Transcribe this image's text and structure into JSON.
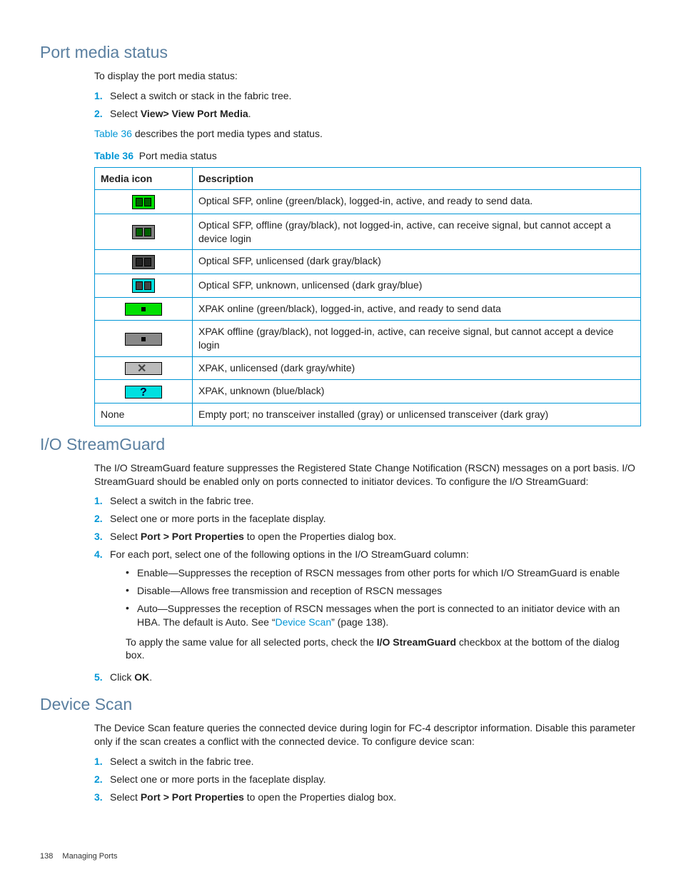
{
  "sections": {
    "portMedia": {
      "title": "Port media status",
      "intro": "To display the port media status:",
      "steps": [
        {
          "n": "1.",
          "text": "Select a switch or stack in the fabric tree."
        },
        {
          "n": "2.",
          "prefix": "Select ",
          "bold": "View> View Port Media",
          "suffix": "."
        }
      ],
      "afterSteps": {
        "link": "Table 36",
        "rest": " describes the port media types and status."
      },
      "tableCaption": {
        "label": "Table 36",
        "title": "Port media status"
      },
      "tableHeaders": {
        "c1": "Media icon",
        "c2": "Description"
      },
      "rows": [
        {
          "icon": "sfp-green",
          "desc": "Optical SFP, online (green/black), logged-in, active, and ready to send data."
        },
        {
          "icon": "sfp-gray",
          "desc": "Optical SFP, offline (gray/black), not logged-in, active, can receive signal, but cannot accept a device login"
        },
        {
          "icon": "sfp-dark",
          "desc": "Optical SFP, unlicensed (dark gray/black)"
        },
        {
          "icon": "sfp-blue",
          "desc": "Optical SFP, unknown, unlicensed (dark gray/blue)"
        },
        {
          "icon": "xpak-green",
          "desc": "XPAK online (green/black), logged-in, active, and ready to send data"
        },
        {
          "icon": "xpak-gray",
          "desc": "XPAK offline (gray/black), not logged-in, active, can receive signal, but cannot accept a device login"
        },
        {
          "icon": "xpak-white",
          "desc": "XPAK, unlicensed (dark gray/white)"
        },
        {
          "icon": "xpak-blue",
          "desc": "XPAK, unknown (blue/black)"
        },
        {
          "icon": "none",
          "iconText": "None",
          "desc": "Empty port; no transceiver installed (gray) or unlicensed transceiver (dark gray)"
        }
      ]
    },
    "streamGuard": {
      "title": "I/O StreamGuard",
      "intro": "The I/O StreamGuard feature suppresses the Registered State Change Notification (RSCN) messages on a port basis. I/O StreamGuard should be enabled only on ports connected to initiator devices. To configure the I/O StreamGuard:",
      "steps": {
        "s1": {
          "n": "1.",
          "text": "Select a switch in the fabric tree."
        },
        "s2": {
          "n": "2.",
          "text": "Select one or more ports in the faceplate display."
        },
        "s3": {
          "n": "3.",
          "prefix": "Select ",
          "bold": "Port > Port Properties",
          "suffix": " to open the Properties dialog box."
        },
        "s4": {
          "n": "4.",
          "text": "For each port, select one of the following options in the I/O StreamGuard column:"
        },
        "s5": {
          "n": "5.",
          "prefix": "Click ",
          "bold": "OK",
          "suffix": "."
        }
      },
      "bullets": [
        "Enable—Suppresses the reception of RSCN messages from other ports for which I/O StreamGuard is enable",
        "Disable—Allows free transmission and reception of RSCN messages"
      ],
      "bullet3": {
        "pre": "Auto—Suppresses the reception of RSCN messages when the port is connected to an initiator device with an HBA. The default is Auto. See “",
        "link": "Device Scan",
        "post": "” (page 138)."
      },
      "applyNote": {
        "pre": "To apply the same value for all selected ports, check the ",
        "bold": "I/O StreamGuard",
        "post": " checkbox at the bottom of the dialog box."
      }
    },
    "deviceScan": {
      "title": "Device Scan",
      "intro": "The Device Scan feature queries the connected device during login for FC-4 descriptor information. Disable this parameter only if the scan creates a conflict with the connected device. To configure device scan:",
      "steps": {
        "s1": {
          "n": "1.",
          "text": "Select a switch in the fabric tree."
        },
        "s2": {
          "n": "2.",
          "text": "Select one or more ports in the faceplate display."
        },
        "s3": {
          "n": "3.",
          "prefix": "Select ",
          "bold": "Port > Port Properties",
          "suffix": " to open the Properties dialog box."
        }
      }
    }
  },
  "footer": {
    "page": "138",
    "chapter": "Managing Ports"
  }
}
